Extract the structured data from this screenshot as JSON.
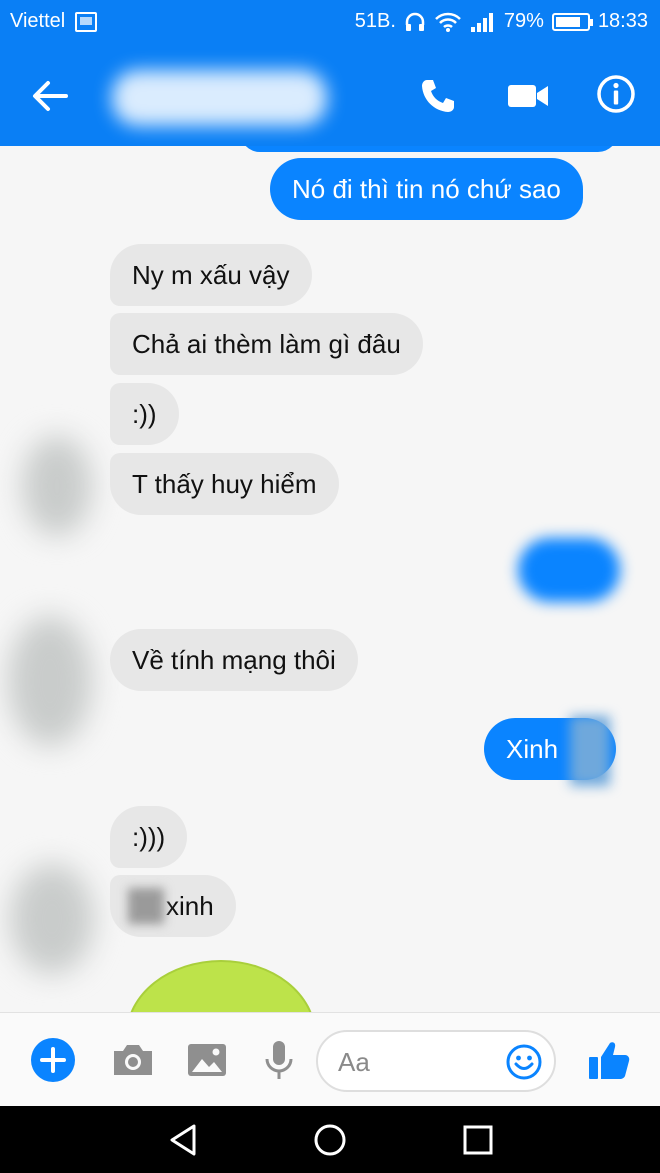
{
  "status_bar": {
    "carrier": "Viettel",
    "network_badge": "51B.",
    "battery": "79%",
    "battery_level": 0.79,
    "time": "18:33",
    "icons": [
      "sim-icon",
      "headset-icon",
      "wifi-icon",
      "signal-icon",
      "battery-icon"
    ]
  },
  "header": {
    "icons": [
      "back-arrow-icon",
      "phone-call-icon",
      "video-call-icon",
      "info-icon"
    ]
  },
  "messages": [
    {
      "direction": "outgoing",
      "text": "Nó đi thì tin nó chứ sao"
    },
    {
      "direction": "incoming",
      "text": "Ny m xấu vậy"
    },
    {
      "direction": "incoming",
      "text": "Chả ai thèm làm gì đâu"
    },
    {
      "direction": "incoming",
      "text": ":))"
    },
    {
      "direction": "incoming",
      "text": "T thấy huy hiểm"
    },
    {
      "direction": "outgoing",
      "text": ""
    },
    {
      "direction": "incoming",
      "text": "Về tính mạng thôi"
    },
    {
      "direction": "outgoing",
      "text": "Xinh"
    },
    {
      "direction": "incoming",
      "text": ":)))"
    },
    {
      "direction": "incoming",
      "text": "xinh"
    }
  ],
  "composer": {
    "placeholder": "Aa",
    "icons": [
      "add-icon",
      "camera-icon",
      "gallery-icon",
      "microphone-icon",
      "emoji-icon",
      "like-icon"
    ]
  },
  "colors": {
    "brand_blue": "#0a7ff5",
    "outgoing_bubble": "#0a84ff",
    "incoming_bubble": "#e7e7e7",
    "sticker_green": "#bde34a"
  },
  "nav_bar": {
    "icons": [
      "nav-back-icon",
      "nav-home-icon",
      "nav-recents-icon"
    ]
  }
}
